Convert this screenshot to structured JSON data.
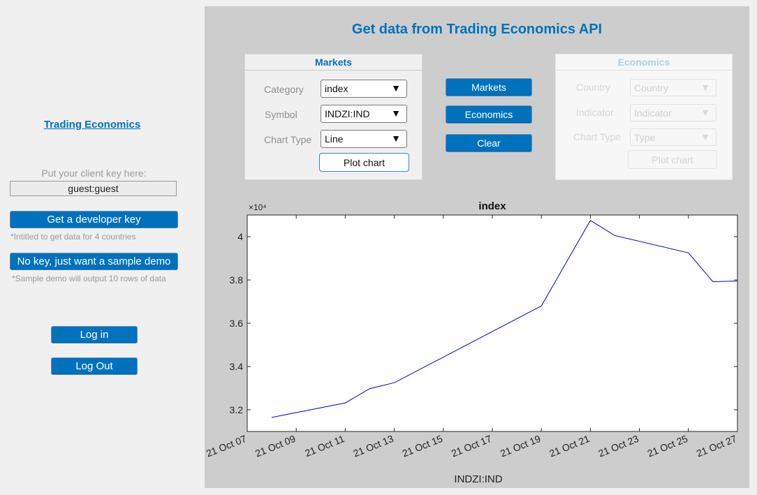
{
  "left_panel": {
    "link_text": "Trading Economics",
    "key_label": "Put your client key here:",
    "key_value": "guest:guest",
    "dev_key_button": "Get a developer key",
    "dev_key_note": "*Intitled to get data for 4 countries",
    "demo_button": "No key, just want a sample demo",
    "demo_note": "*Sample demo will output 10 rows of data",
    "login_button": "Log in",
    "logout_button": "Log Out"
  },
  "main": {
    "title": "Get data from Trading Economics API"
  },
  "markets": {
    "title": "Markets",
    "category_label": "Category",
    "category_value": "index",
    "symbol_label": "Symbol",
    "symbol_value": "INDZI:IND",
    "chart_type_label": "Chart Type",
    "chart_type_value": "Line",
    "plot_button": "Plot chart"
  },
  "actions": {
    "markets": "Markets",
    "economics": "Economics",
    "clear": "Clear"
  },
  "economics": {
    "title": "Economics",
    "country_label": "Country",
    "country_value": "Country",
    "indicator_label": "Indicator",
    "indicator_value": "Indicator",
    "chart_type_label": "Chart Type",
    "chart_type_value": "Type",
    "plot_button": "Plot chart"
  },
  "icons": {
    "dropdown_arrow": "▼"
  },
  "colors": {
    "accent": "#0072bd",
    "line": "#0000cc"
  },
  "chart_data": {
    "type": "line",
    "title": "index",
    "xlabel": "INDZI:IND",
    "ylabel": "",
    "y_exponent_label": "×10⁴",
    "x_tick_labels": [
      "21 Oct 07",
      "21 Oct 09",
      "21 Oct 11",
      "21 Oct 13",
      "21 Oct 15",
      "21 Oct 17",
      "21 Oct 19",
      "21 Oct 21",
      "21 Oct 23",
      "21 Oct 25",
      "21 Oct 27"
    ],
    "y_ticks": [
      3.2,
      3.4,
      3.6,
      3.8,
      4
    ],
    "ylim": [
      3.1,
      4.1
    ],
    "grid": true,
    "series": [
      {
        "x": [
          "21 Oct 08",
          "21 Oct 11",
          "21 Oct 12",
          "21 Oct 13",
          "21 Oct 19",
          "21 Oct 21",
          "21 Oct 22",
          "21 Oct 25",
          "21 Oct 26",
          "21 Oct 27"
        ],
        "values": [
          3.165,
          3.232,
          3.298,
          3.325,
          3.68,
          4.075,
          4.005,
          3.925,
          3.792,
          3.795
        ]
      }
    ]
  }
}
